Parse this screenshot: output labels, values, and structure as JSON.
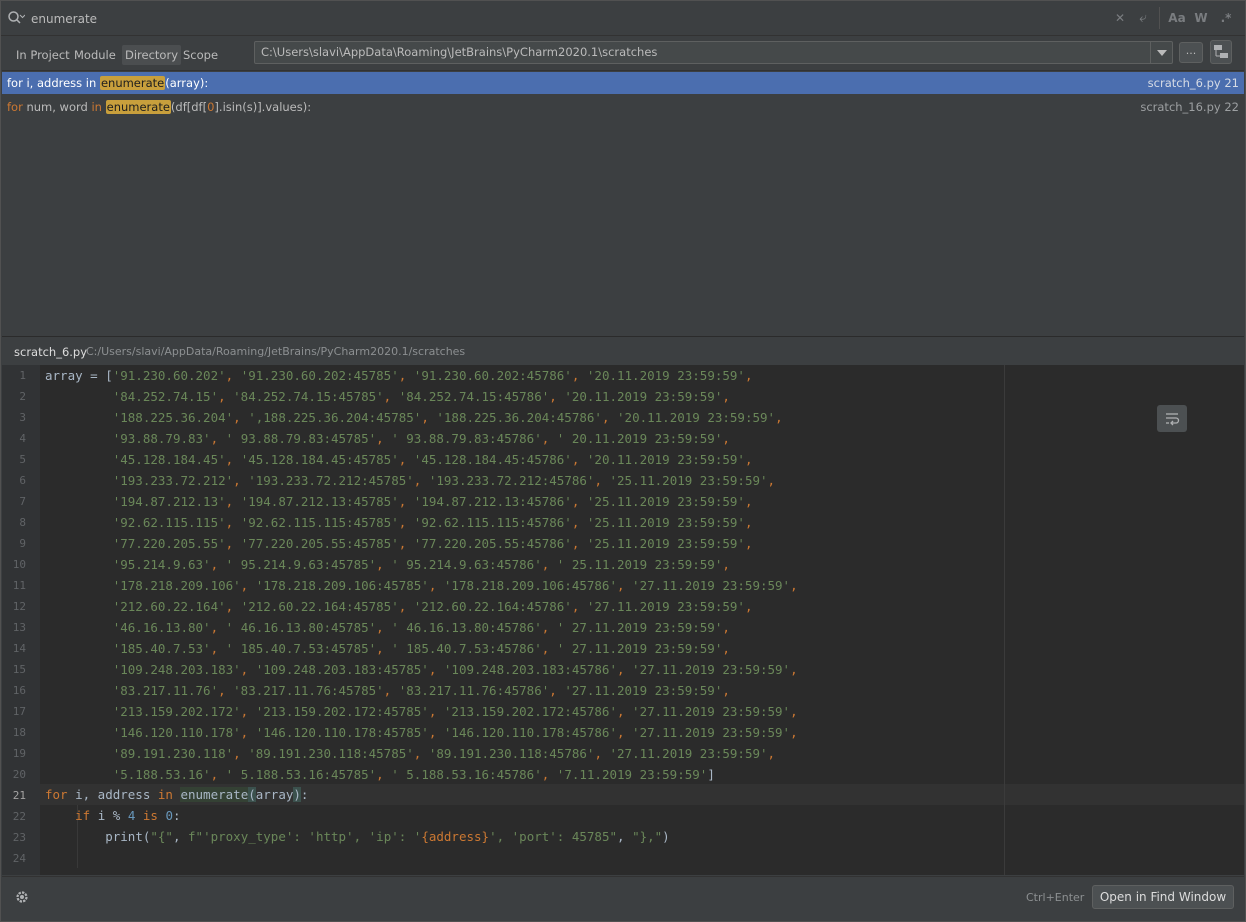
{
  "search": {
    "query": "enumerate",
    "clear_label": "✕",
    "newline_label": "⤶",
    "match_case_label": "Aa",
    "words_label": "W",
    "regex_label": ".*"
  },
  "scope": {
    "tabs": [
      "In Project",
      "Module",
      "Directory",
      "Scope"
    ],
    "active_tab": "Directory",
    "directory": "C:\\Users\\slavi\\AppData\\Roaming\\JetBrains\\PyCharm2020.1\\scratches",
    "browse_label": "..."
  },
  "results": [
    {
      "pre": "for i, address in ",
      "match": "enumerate",
      "post": "(array):",
      "file": "scratch_6.py 21",
      "selected": true
    },
    {
      "kw1": "for",
      "mid1": " num, word ",
      "kw2": "in",
      "match": "enumerate",
      "post1": "(df[df[",
      "num": "0",
      "post2": "].isin(s)].values):",
      "file": "scratch_16.py 22",
      "selected": false
    }
  ],
  "preview": {
    "file": "scratch_6.py",
    "path": "C:/Users/slavi/AppData/Roaming/JetBrains/PyCharm2020.1/scratches"
  },
  "editor": {
    "line_numbers": [
      "1",
      "2",
      "3",
      "4",
      "5",
      "6",
      "7",
      "8",
      "9",
      "10",
      "11",
      "12",
      "13",
      "14",
      "15",
      "16",
      "17",
      "18",
      "19",
      "20",
      "21",
      "22",
      "23",
      "24"
    ],
    "array_prefix": "array = [",
    "array_rows": [
      [
        "'91.230.60.202'",
        "'91.230.60.202:45785'",
        "'91.230.60.202:45786'",
        "'20.11.2019 23:59:59'"
      ],
      [
        "'84.252.74.15'",
        "'84.252.74.15:45785'",
        "'84.252.74.15:45786'",
        "'20.11.2019 23:59:59'"
      ],
      [
        "'188.225.36.204'",
        "',188.225.36.204:45785'",
        "'188.225.36.204:45786'",
        "'20.11.2019 23:59:59'"
      ],
      [
        "'93.88.79.83'",
        "' 93.88.79.83:45785'",
        "' 93.88.79.83:45786'",
        "' 20.11.2019 23:59:59'"
      ],
      [
        "'45.128.184.45'",
        "'45.128.184.45:45785'",
        "'45.128.184.45:45786'",
        "'20.11.2019 23:59:59'"
      ],
      [
        "'193.233.72.212'",
        "'193.233.72.212:45785'",
        "'193.233.72.212:45786'",
        "'25.11.2019 23:59:59'"
      ],
      [
        "'194.87.212.13'",
        "'194.87.212.13:45785'",
        "'194.87.212.13:45786'",
        "'25.11.2019 23:59:59'"
      ],
      [
        "'92.62.115.115'",
        "'92.62.115.115:45785'",
        "'92.62.115.115:45786'",
        "'25.11.2019 23:59:59'"
      ],
      [
        "'77.220.205.55'",
        "'77.220.205.55:45785'",
        "'77.220.205.55:45786'",
        "'25.11.2019 23:59:59'"
      ],
      [
        "'95.214.9.63'",
        "' 95.214.9.63:45785'",
        "' 95.214.9.63:45786'",
        "' 25.11.2019 23:59:59'"
      ],
      [
        "'178.218.209.106'",
        "'178.218.209.106:45785'",
        "'178.218.209.106:45786'",
        "'27.11.2019 23:59:59'"
      ],
      [
        "'212.60.22.164'",
        "'212.60.22.164:45785'",
        "'212.60.22.164:45786'",
        "'27.11.2019 23:59:59'"
      ],
      [
        "'46.16.13.80'",
        "' 46.16.13.80:45785'",
        "' 46.16.13.80:45786'",
        "' 27.11.2019 23:59:59'"
      ],
      [
        "'185.40.7.53'",
        "' 185.40.7.53:45785'",
        "' 185.40.7.53:45786'",
        "' 27.11.2019 23:59:59'"
      ],
      [
        "'109.248.203.183'",
        "'109.248.203.183:45785'",
        "'109.248.203.183:45786'",
        "'27.11.2019 23:59:59'"
      ],
      [
        "'83.217.11.76'",
        "'83.217.11.76:45785'",
        "'83.217.11.76:45786'",
        "'27.11.2019 23:59:59'"
      ],
      [
        "'213.159.202.172'",
        "'213.159.202.172:45785'",
        "'213.159.202.172:45786'",
        "'27.11.2019 23:59:59'"
      ],
      [
        "'146.120.110.178'",
        "'146.120.110.178:45785'",
        "'146.120.110.178:45786'",
        "'27.11.2019 23:59:59'"
      ],
      [
        "'89.191.230.118'",
        "'89.191.230.118:45785'",
        "'89.191.230.118:45786'",
        "'27.11.2019 23:59:59'"
      ],
      [
        "'5.188.53.16'",
        "' 5.188.53.16:45785'",
        "' 5.188.53.16:45786'",
        "'7.11.2019 23:59:59'"
      ]
    ],
    "line21": {
      "for": "for",
      "mid": " i, address ",
      "in": "in",
      "fn": "enumerate",
      "arg": "array",
      "end": ":"
    },
    "line22": {
      "if": "if",
      "mid": " i % ",
      "n1": "4",
      "is": "is",
      "n2": "0",
      "end": ":"
    },
    "line23": {
      "pre": "print(",
      "s1": "\"{\"",
      "comma1": ", ",
      "fprefix": "f",
      "s2": "\"'proxy_type': 'http', 'ip': '",
      "expr": "{address}",
      "s3": "', 'port': 45785\"",
      "comma2": ", ",
      "s4": "\"},\"",
      "post": ")"
    }
  },
  "bottom": {
    "shortcut": "Ctrl+Enter",
    "open_label": "Open in Find Window"
  }
}
